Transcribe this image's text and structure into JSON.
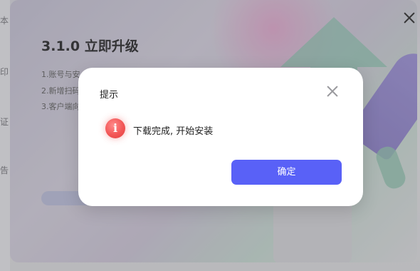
{
  "background_app": {
    "left_fragments": [
      "本",
      "印",
      "证",
      "告"
    ],
    "update": {
      "title": "3.1.0 立即升级",
      "lines": [
        "1.账号与安",
        "2.新增扫码",
        "3.客户端向"
      ]
    }
  },
  "dialog": {
    "title": "提示",
    "icon": "info-icon",
    "message": "下载完成, 开始安装",
    "confirm_label": "确定"
  },
  "colors": {
    "accent": "#5961f7",
    "info_icon": "#f25656"
  }
}
